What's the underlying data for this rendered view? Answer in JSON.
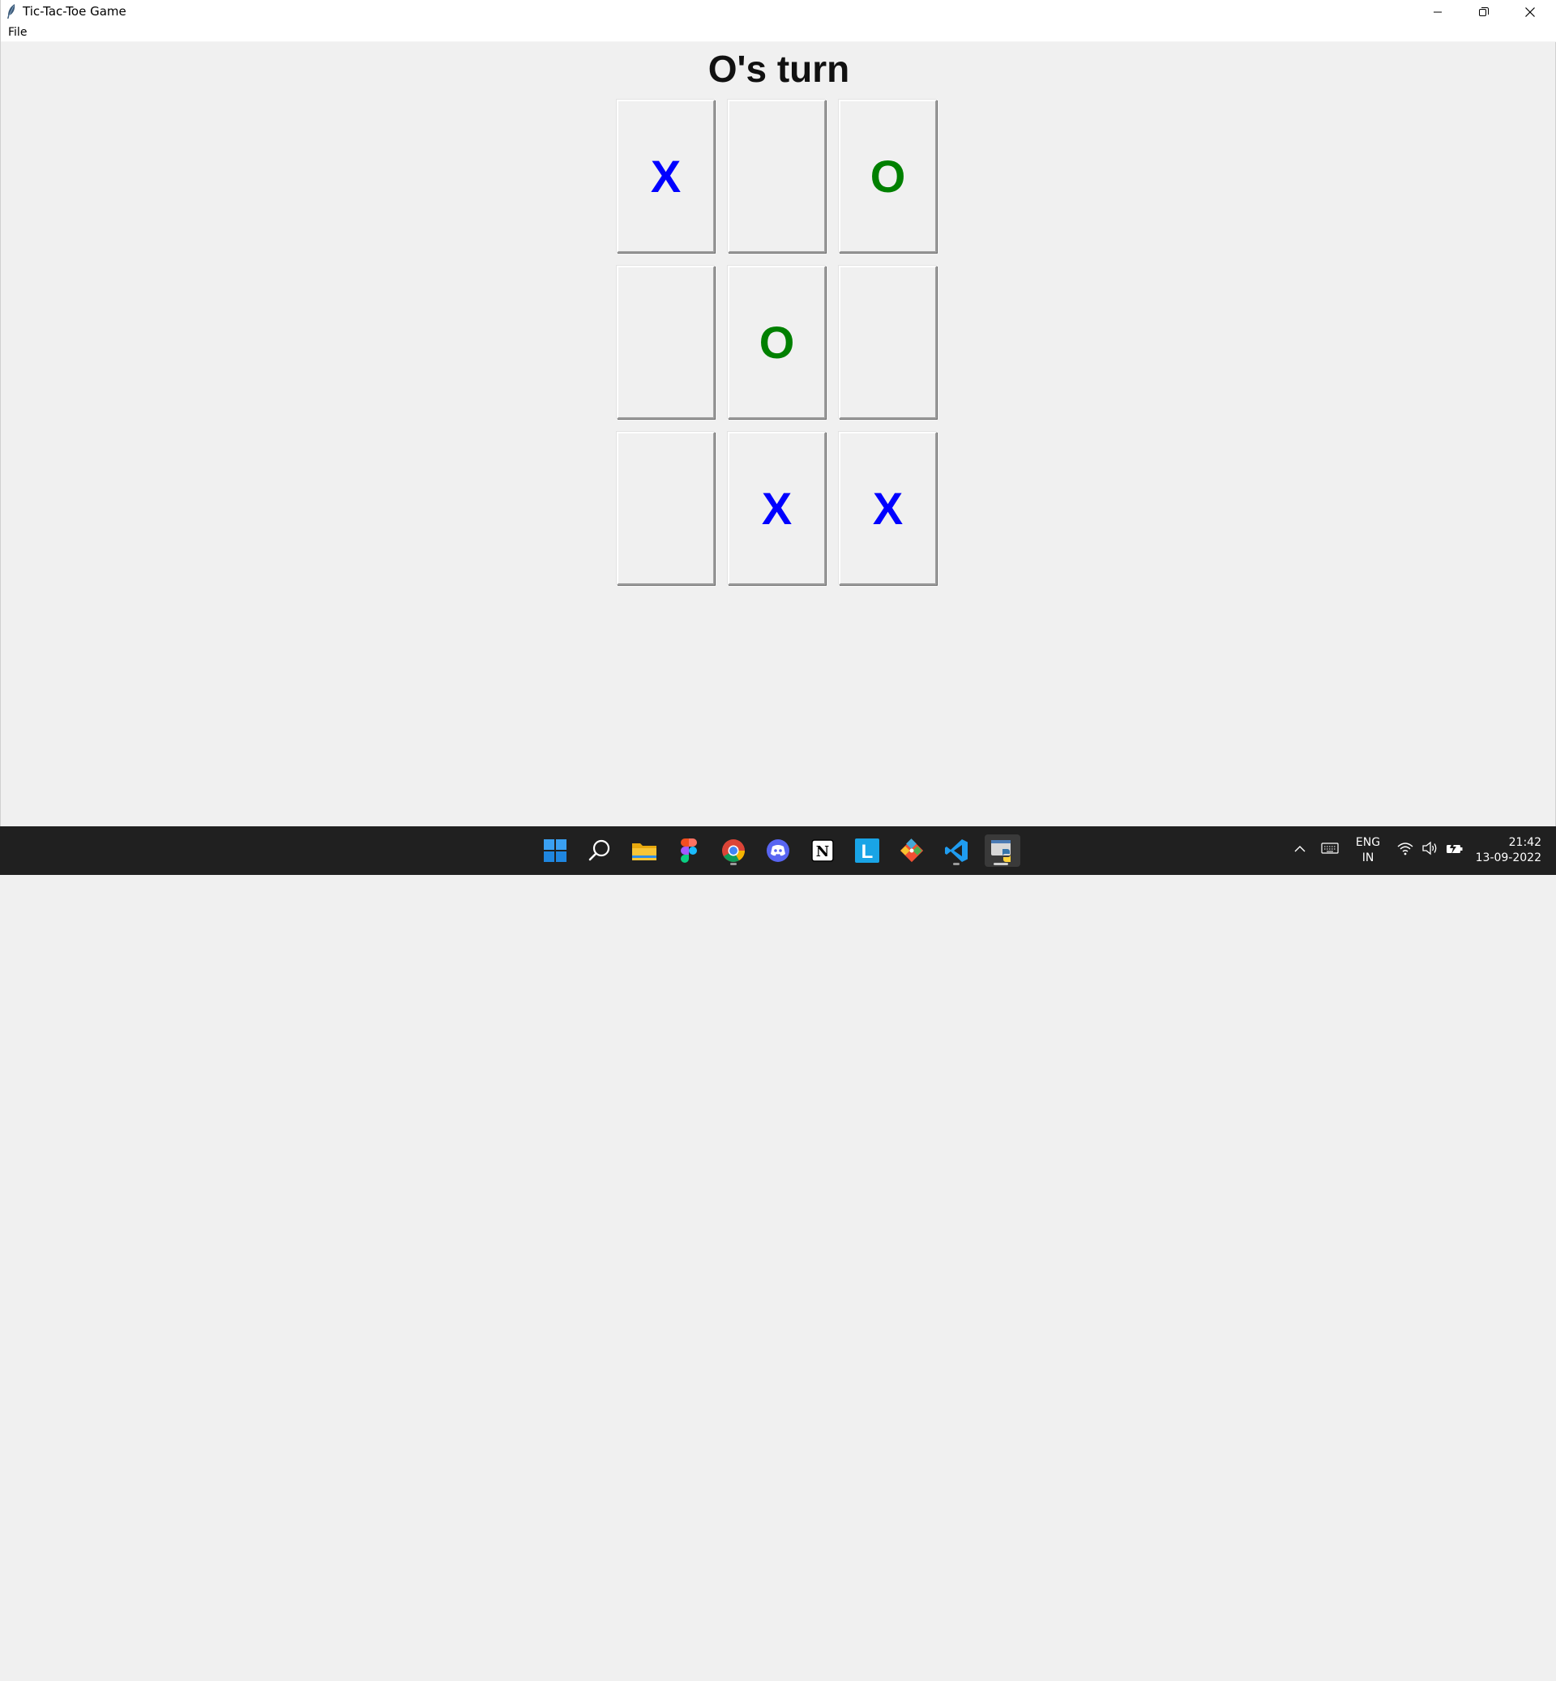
{
  "window": {
    "title": "Tic-Tac-Toe Game",
    "controls": {
      "minimize": "minimize-icon",
      "restore": "restore-icon",
      "close": "close-icon"
    }
  },
  "menubar": {
    "items": [
      {
        "label": "File"
      }
    ]
  },
  "game": {
    "status": "O's turn",
    "colors": {
      "x": "#0000ff",
      "o": "#008000"
    },
    "board": [
      [
        "X",
        "",
        "O"
      ],
      [
        "",
        "O",
        ""
      ],
      [
        "",
        "X",
        "X"
      ]
    ]
  },
  "taskbar": {
    "apps": [
      "windows-start-icon",
      "search-icon",
      "file-explorer-icon",
      "figma-icon",
      "chrome-icon",
      "discord-icon",
      "notion-icon",
      "l-app-icon",
      "git-icon",
      "vscode-icon",
      "python-icon"
    ],
    "tray": {
      "language_line1": "ENG",
      "language_line2": "IN",
      "time": "21:42",
      "date": "13-09-2022"
    }
  }
}
